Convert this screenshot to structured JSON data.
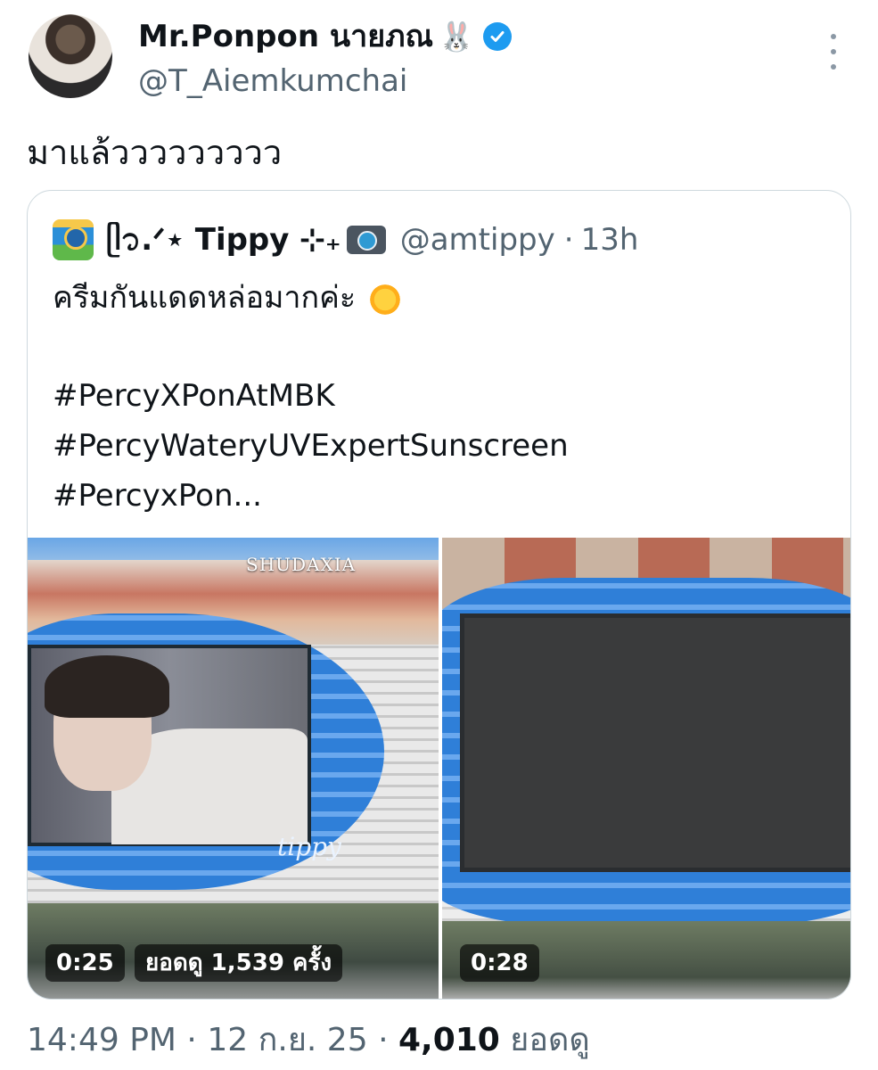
{
  "tweet": {
    "author": {
      "display_name": "Mr.Ponpon นายภณ",
      "emoji": "🐰",
      "handle": "@T_Aiemkumchai",
      "verified": true
    },
    "text": "มาแล้ววววววววว",
    "footer": {
      "time": "14:49 PM",
      "date": "12 ก.ย. 25",
      "sep": "·",
      "views_count": "4,010",
      "views_label": "ยอดดู"
    }
  },
  "quoted": {
    "name": "ᥫ᭡.ᐟ⋆ Tippy ⊹₊",
    "handle": "@amtippy",
    "age": "13h",
    "sep": "·",
    "lines": [
      "ครีมกันแดดหล่อมากค่ะ",
      "#PercyXPonAtMBK",
      "#PercyWateryUVExpertSunscreen",
      "#PercyxPon..."
    ],
    "media": [
      {
        "duration": "0:25",
        "views": "ยอดดู 1,539 ครั้ง",
        "sign": "SHUDAXIA",
        "watermark": "tippy"
      },
      {
        "duration": "0:28"
      }
    ]
  },
  "colors": {
    "verified_blue": "#1d9bf0",
    "secondary_text": "#536471",
    "primary_text": "#0f1419"
  },
  "icons": [
    "rabbit-emoji",
    "verified-badge-icon",
    "more-options-icon",
    "island-emoji-avatar",
    "camera-emoji",
    "sun-emoji"
  ]
}
